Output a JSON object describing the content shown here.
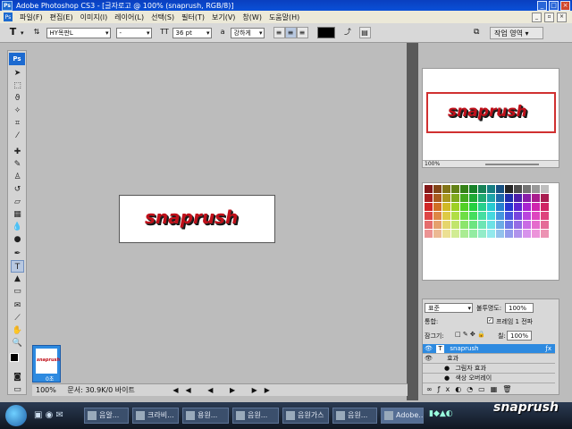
{
  "window": {
    "title": "Adobe Photoshop CS3 - [글자로고 @ 100% (snaprush, RGB/8)]",
    "app_badge": "Ps"
  },
  "menu": [
    "파일(F)",
    "편집(E)",
    "이미지(I)",
    "레이어(L)",
    "선택(S)",
    "필터(T)",
    "보기(V)",
    "창(W)",
    "도움말(H)"
  ],
  "options": {
    "font_family": "HY목판L",
    "font_style": "-",
    "font_size": "36 pt",
    "anti_alias": "강하게",
    "workspace_label": "작업 영역 ▾"
  },
  "document": {
    "text": "snaprush",
    "zoom": "100%",
    "status_zoom": "100%",
    "status_text": "문서: 30.9K/0 바이트"
  },
  "navigator": {
    "zoom": "100%"
  },
  "layers": {
    "blend_mode": "표준",
    "opacity_label": "불투명도:",
    "opacity": "100%",
    "unify_label": "통합:",
    "propagate_label": "프레임 1 전파",
    "lock_label": "잠그기:",
    "fill_label": "칠:",
    "fill": "100%",
    "rows": [
      {
        "name": "snaprush",
        "kind": "text-layer",
        "selected": true
      },
      {
        "name": "효과",
        "kind": "effects"
      },
      {
        "name": "그림자 효과",
        "kind": "effect"
      },
      {
        "name": "색상 오버레이",
        "kind": "effect"
      }
    ]
  },
  "history": {
    "thumb_label": "0초"
  },
  "taskbar": {
    "items": [
      "음알...",
      "크라비...",
      "용원...",
      "음원...",
      "음원가스",
      "음원...",
      "난판...",
      "Adobe..."
    ],
    "watermark": "snaprush"
  },
  "colors": {
    "title_bar": "#0a50d8",
    "menu_bar": "#ece9d8",
    "workspace_bg": "#bcbcbc",
    "logo_red": "#c0101a",
    "selection_blue": "#2d8ae0"
  }
}
